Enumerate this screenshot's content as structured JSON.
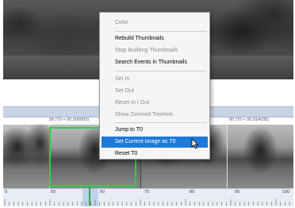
{
  "context_menu": {
    "items": [
      {
        "label": "Color",
        "enabled": false
      },
      {
        "label": "Rebuild Thumbnails",
        "enabled": true
      },
      {
        "label": "Stop Building Thumbnails",
        "enabled": false
      },
      {
        "label": "Search Events in Thumbnails",
        "enabled": true
      },
      {
        "label": "Set In",
        "enabled": false
      },
      {
        "label": "Set Out",
        "enabled": false
      },
      {
        "label": "Reset In / Out",
        "enabled": false
      },
      {
        "label": "Show Zoomed Timeline",
        "enabled": false
      },
      {
        "label": "Jump to T0",
        "enabled": true
      },
      {
        "label": "Set Current Image as T0",
        "enabled": true,
        "highlighted": true
      },
      {
        "label": "Reset T0",
        "enabled": true
      }
    ],
    "highlight_color": "#1e7ad9"
  },
  "timeline": {
    "frame_labels": [
      "58 (T0 + 00.000000)",
      "60 (T0 + 00.014035)"
    ],
    "ruler_numbers": [
      "0",
      "50",
      "60",
      "70",
      "80",
      "90",
      "100"
    ],
    "selection_color": "#25d34a"
  }
}
